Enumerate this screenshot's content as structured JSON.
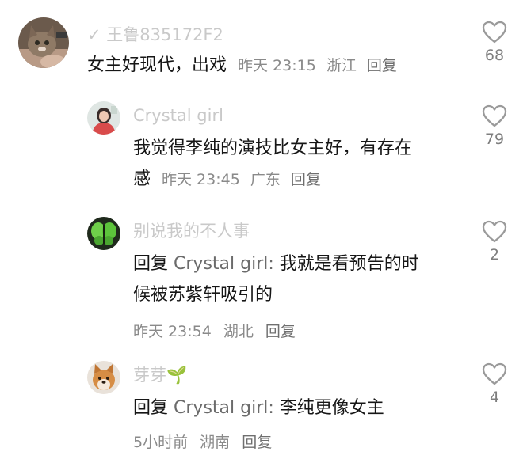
{
  "comments": [
    {
      "username": "✓ 王鲁835172F2",
      "text": "女主好现代，出戏",
      "time": "昨天 23:15",
      "location": "浙江",
      "reply_label": "回复",
      "likes": "68",
      "avatar_icon": "cat-avatar"
    },
    {
      "username": "Crystal  girl",
      "text_line1": "我觉得李纯的演技比女主好，有存在",
      "text_line2": "感",
      "time": "昨天 23:45",
      "location": "广东",
      "reply_label": "回复",
      "likes": "79",
      "avatar_icon": "girl-avatar"
    },
    {
      "username": "别说我的不人事",
      "reply_prefix": "回复",
      "reply_target": "Crystal  girl:",
      "text_line1": " 我就是看预告的时",
      "text_line2": "候被苏紫轩吸引的",
      "time": "昨天 23:54",
      "location": "湖北",
      "reply_label": "回复",
      "likes": "2",
      "avatar_icon": "butterfly-avatar"
    },
    {
      "username": "芽芽🌱",
      "reply_prefix": "回复",
      "reply_target": "Crystal  girl:",
      "text_line1": " 李纯更像女主",
      "time": "5小时前",
      "location": "湖南",
      "reply_label": "回复",
      "likes": "4",
      "avatar_icon": "dog-avatar"
    }
  ]
}
